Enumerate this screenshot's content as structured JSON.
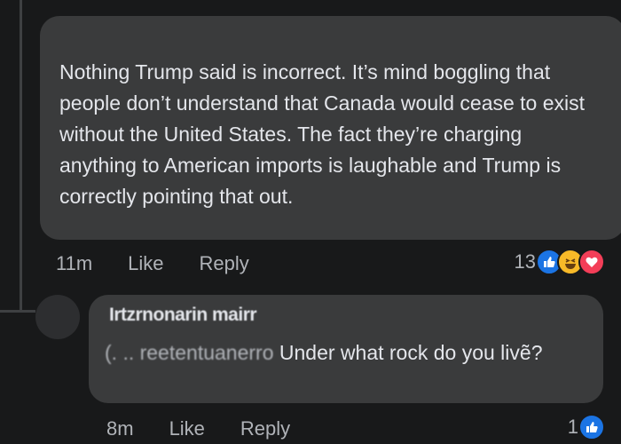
{
  "comment": {
    "text": "Nothing Trump said is incorrect. It’s mind boggling that people don’t understand that Canada would cease to exist without the United States. The fact they’re charging anything to American imports is laughable and Trump is correctly pointing that out.",
    "time": "11m",
    "like_label": "Like",
    "reply_label": "Reply",
    "reaction_count": "13",
    "reactions": [
      "like-icon",
      "haha-icon",
      "love-icon"
    ]
  },
  "reply": {
    "author": "Irtzrnonarin mairr",
    "mention": "(. .. reetentuanerro",
    "text": " Under what rock do you livẽ?",
    "time": "8m",
    "like_label": "Like",
    "reply_label": "Reply",
    "reaction_count": "1",
    "reactions": [
      "like-icon"
    ]
  },
  "colors": {
    "background": "#18191a",
    "bubble": "#3a3b3c",
    "text": "#e4e6eb",
    "meta": "#b0b3b8",
    "like": "#1b74e4",
    "haha": "#f7b928",
    "love": "#f33e58"
  }
}
